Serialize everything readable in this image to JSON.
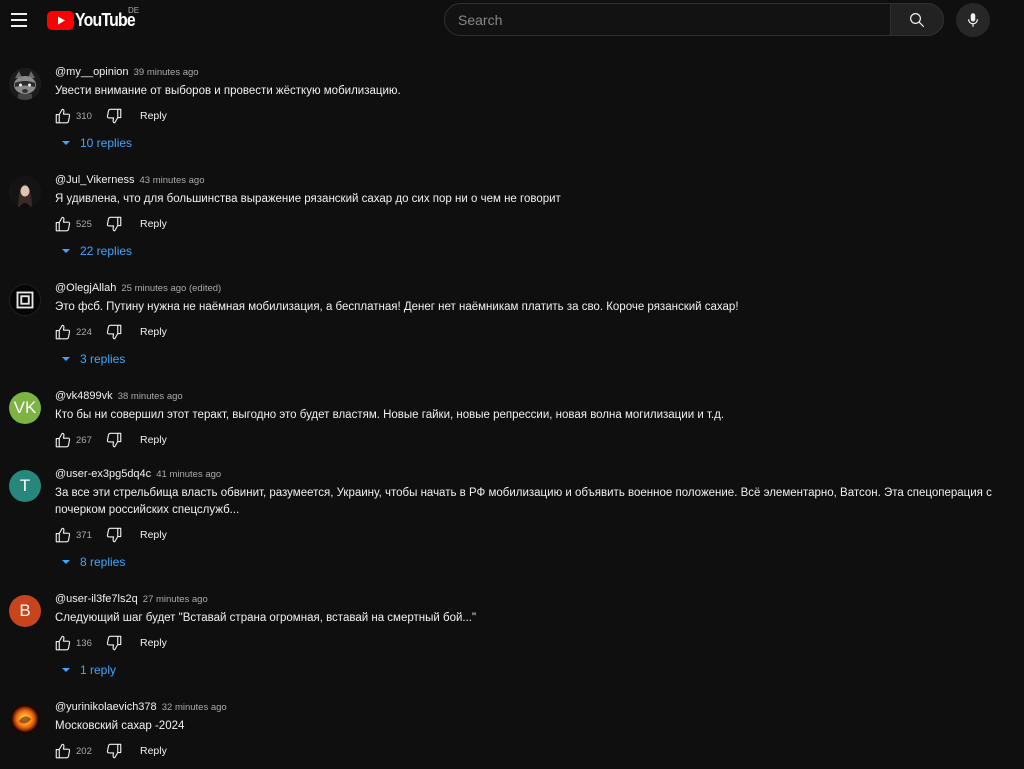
{
  "header": {
    "logo_text": "YouTube",
    "country_code": "DE",
    "search_placeholder": "Search"
  },
  "colors": {
    "brand_red": "#ff0000",
    "link_blue": "#3ea6ff",
    "background": "#0f0f0f"
  },
  "comments": [
    {
      "author": "@my__opinion",
      "time": "39 minutes ago",
      "text": "Увести внимание от выборов и провести жёсткую мобилизацию.",
      "likes": "310",
      "reply_label": "Reply",
      "replies": "10 replies",
      "avatar": {
        "kind": "image",
        "icon": "raccoon-avatar-icon"
      }
    },
    {
      "author": "@Jul_Vikerness",
      "time": "43 minutes ago",
      "text": "Я удивлена,  что для большинства выражение рязанский сахар до сих пор ни о чем не говорит",
      "likes": "525",
      "reply_label": "Reply",
      "replies": "22 replies",
      "avatar": {
        "kind": "image",
        "icon": "portrait-avatar-icon"
      }
    },
    {
      "author": "@OlegjAllah",
      "time": "25 minutes ago (edited)",
      "text": "Это фсб. Путину нужна не наёмная мобилизация, а бесплатная! Денег нет наёмникам платить за сво. Короче рязанский сахар!",
      "likes": "224",
      "reply_label": "Reply",
      "replies": "3 replies",
      "avatar": {
        "kind": "image",
        "icon": "square-logo-avatar-icon"
      }
    },
    {
      "author": "@vk4899vk",
      "time": "38 minutes ago",
      "text": "Кто бы ни совершил этот теракт, выгодно это будет властям. Новые гайки, новые репрессии, новая волна могилизации и т.д.",
      "likes": "267",
      "reply_label": "Reply",
      "replies": "",
      "avatar": {
        "kind": "letter",
        "letter": "VK",
        "color": "#7cb342"
      }
    },
    {
      "author": "@user-ex3pg5dq4c",
      "time": "41 minutes ago",
      "text": "За все эти стрельбища власть обвинит, разумеется, Украину, чтобы начать в РФ мобилизацию и объявить военное положение. Всё элементарно, Ватсон. Эта спецоперация с почерком российских спецслужб...",
      "likes": "371",
      "reply_label": "Reply",
      "replies": "8 replies",
      "avatar": {
        "kind": "letter",
        "letter": "T",
        "color": "#26877a"
      }
    },
    {
      "author": "@user-il3fe7ls2q",
      "time": "27 minutes ago",
      "text": "Следующий шаг будет \"Вставай страна огромная, вставай на смертный бой...\"",
      "likes": "136",
      "reply_label": "Reply",
      "replies": "1 reply",
      "avatar": {
        "kind": "letter",
        "letter": "B",
        "color": "#c8441c"
      }
    },
    {
      "author": "@yurinikolaevich378",
      "time": "32 minutes ago",
      "text": "Московский сахар -2024",
      "likes": "202",
      "reply_label": "Reply",
      "replies": "",
      "avatar": {
        "kind": "image",
        "icon": "fireball-avatar-icon"
      }
    }
  ]
}
